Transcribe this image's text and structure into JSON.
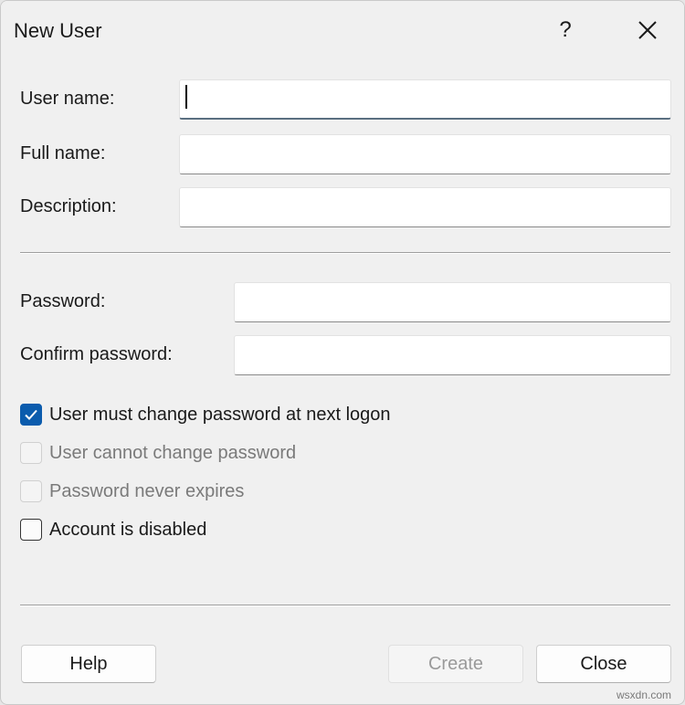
{
  "dialog": {
    "title": "New User",
    "help_glyph": "?",
    "close_icon": "close-icon"
  },
  "form": {
    "username_label": "User name:",
    "username_value": "",
    "fullname_label": "Full name:",
    "fullname_value": "",
    "description_label": "Description:",
    "description_value": "",
    "password_label": "Password:",
    "password_value": "",
    "confirm_label": "Confirm password:",
    "confirm_value": ""
  },
  "options": [
    {
      "label": "User must change password at next logon",
      "checked": true,
      "enabled": true
    },
    {
      "label": "User cannot change password",
      "checked": false,
      "enabled": false
    },
    {
      "label": "Password never expires",
      "checked": false,
      "enabled": false
    },
    {
      "label": "Account is disabled",
      "checked": false,
      "enabled": true
    }
  ],
  "buttons": {
    "help": "Help",
    "create": "Create",
    "close": "Close"
  },
  "colors": {
    "accent": "#0b5cad",
    "background": "#f0f0f0"
  },
  "watermark": "wsxdn.com"
}
